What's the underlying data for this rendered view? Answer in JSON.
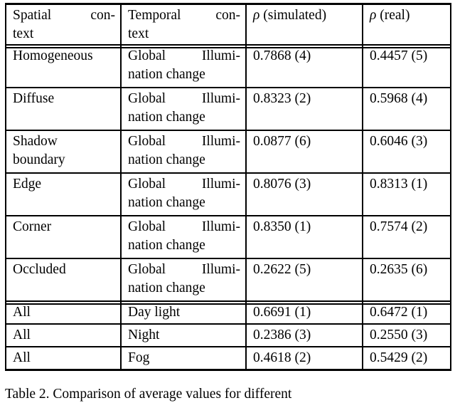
{
  "document": {
    "type": "academic-table",
    "caption": "Table 2.  Comparison of average values for different"
  },
  "table": {
    "columns": [
      {
        "header_line1": "Spatial",
        "header_line2": "con-",
        "header_line3": "text",
        "label": "Spatial context"
      },
      {
        "header_line1": "Temporal",
        "header_line2": "con-",
        "header_line3": "text",
        "label": "Temporal context"
      },
      {
        "symbol": "ρ",
        "suffix": " (simulated)",
        "label": "rho (simulated)"
      },
      {
        "symbol": "ρ",
        "suffix": " (real)",
        "label": "rho (real)"
      }
    ],
    "group_context": {
      "temporal_word1": "Global",
      "temporal_word2": "Illumi-",
      "temporal_line2": "nation change"
    },
    "rows": [
      {
        "spatial_line1": "Homogeneous",
        "spatial_line2": "",
        "temporal_line1_a": "Global",
        "temporal_line1_b": "Illumi-",
        "temporal_line2": "nation change",
        "rho_simulated": "0.7868 (4)",
        "rho_real": "0.4457 (5)"
      },
      {
        "spatial_line1": "Diffuse",
        "spatial_line2": "",
        "temporal_line1_a": "Global",
        "temporal_line1_b": "Illumi-",
        "temporal_line2": "nation change",
        "rho_simulated": "0.8323 (2)",
        "rho_real": "0.5968 (4)"
      },
      {
        "spatial_line1": "Shadow",
        "spatial_line2": "boundary",
        "temporal_line1_a": "Global",
        "temporal_line1_b": "Illumi-",
        "temporal_line2": "nation change",
        "rho_simulated": "0.0877 (6)",
        "rho_real": "0.6046 (3)"
      },
      {
        "spatial_line1": "Edge",
        "spatial_line2": "",
        "temporal_line1_a": "Global",
        "temporal_line1_b": "Illumi-",
        "temporal_line2": "nation change",
        "rho_simulated": "0.8076 (3)",
        "rho_real": "0.8313 (1)"
      },
      {
        "spatial_line1": "Corner",
        "spatial_line2": "",
        "temporal_line1_a": "Global",
        "temporal_line1_b": "Illumi-",
        "temporal_line2": "nation change",
        "rho_simulated": "0.8350 (1)",
        "rho_real": "0.7574 (2)"
      },
      {
        "spatial_line1": "Occluded",
        "spatial_line2": "",
        "temporal_line1_a": "Global",
        "temporal_line1_b": "Illumi-",
        "temporal_line2": "nation change",
        "rho_simulated": "0.2622 (5)",
        "rho_real": "0.2635 (6)"
      }
    ],
    "summary_rows": [
      {
        "spatial": "All",
        "temporal": "Day light",
        "rho_simulated": "0.6691 (1)",
        "rho_real": "0.6472 (1)"
      },
      {
        "spatial": "All",
        "temporal": "Night",
        "rho_simulated": "0.2386 (3)",
        "rho_real": "0.2550 (3)"
      },
      {
        "spatial": "All",
        "temporal": "Fog",
        "rho_simulated": "0.4618 (2)",
        "rho_real": "0.5429 (2)"
      }
    ]
  }
}
